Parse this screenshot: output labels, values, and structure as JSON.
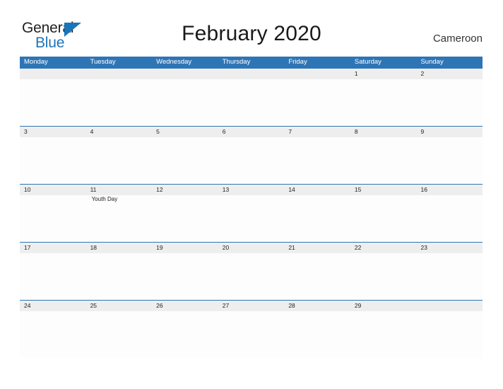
{
  "brand": {
    "name_part1": "General",
    "name_part2": "Blue",
    "flag_icon": "blue-triangle-flag",
    "color_primary": "#1b75bb",
    "color_text": "#231f20"
  },
  "header": {
    "title": "February 2020",
    "locale": "Cameroon"
  },
  "calendar": {
    "header_bg": "#2e75b6",
    "date_band_bg": "#eeeeee",
    "body_bg": "#fdfdfd",
    "weekdays": [
      "Monday",
      "Tuesday",
      "Wednesday",
      "Thursday",
      "Friday",
      "Saturday",
      "Sunday"
    ],
    "weeks": [
      {
        "days": [
          {
            "date": "",
            "event": ""
          },
          {
            "date": "",
            "event": ""
          },
          {
            "date": "",
            "event": ""
          },
          {
            "date": "",
            "event": ""
          },
          {
            "date": "",
            "event": ""
          },
          {
            "date": "1",
            "event": ""
          },
          {
            "date": "2",
            "event": ""
          }
        ]
      },
      {
        "days": [
          {
            "date": "3",
            "event": ""
          },
          {
            "date": "4",
            "event": ""
          },
          {
            "date": "5",
            "event": ""
          },
          {
            "date": "6",
            "event": ""
          },
          {
            "date": "7",
            "event": ""
          },
          {
            "date": "8",
            "event": ""
          },
          {
            "date": "9",
            "event": ""
          }
        ]
      },
      {
        "days": [
          {
            "date": "10",
            "event": ""
          },
          {
            "date": "11",
            "event": "Youth Day"
          },
          {
            "date": "12",
            "event": ""
          },
          {
            "date": "13",
            "event": ""
          },
          {
            "date": "14",
            "event": ""
          },
          {
            "date": "15",
            "event": ""
          },
          {
            "date": "16",
            "event": ""
          }
        ]
      },
      {
        "days": [
          {
            "date": "17",
            "event": ""
          },
          {
            "date": "18",
            "event": ""
          },
          {
            "date": "19",
            "event": ""
          },
          {
            "date": "20",
            "event": ""
          },
          {
            "date": "21",
            "event": ""
          },
          {
            "date": "22",
            "event": ""
          },
          {
            "date": "23",
            "event": ""
          }
        ]
      },
      {
        "days": [
          {
            "date": "24",
            "event": ""
          },
          {
            "date": "25",
            "event": ""
          },
          {
            "date": "26",
            "event": ""
          },
          {
            "date": "27",
            "event": ""
          },
          {
            "date": "28",
            "event": ""
          },
          {
            "date": "29",
            "event": ""
          },
          {
            "date": "",
            "event": ""
          }
        ]
      }
    ]
  }
}
